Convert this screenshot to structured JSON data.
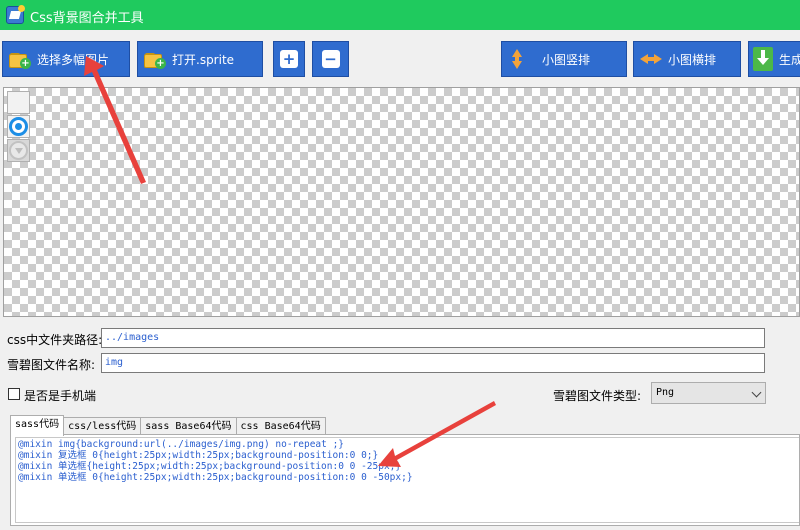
{
  "window": {
    "title": "Css背景图合并工具"
  },
  "toolbar": {
    "select_images_label": "选择多幅图片",
    "open_sprite_label": "打开.sprite",
    "zoom_in_glyph": "+",
    "zoom_out_glyph": "−",
    "arrange_vertical_label": "小图竖排",
    "arrange_horizontal_label": "小图横排",
    "generate_label": "生成"
  },
  "form": {
    "css_path_label": "css中文件夹路径:",
    "css_path_value": "../images",
    "sprite_name_label": "雪碧图文件名称:",
    "sprite_name_value": "img",
    "mobile_checkbox_label": "是否是手机端",
    "mobile_checked": false,
    "file_type_label": "雪碧图文件类型:",
    "file_type_value": "Png"
  },
  "tabs": [
    {
      "label": "sass代码",
      "active": true
    },
    {
      "label": "css/less代码",
      "active": false
    },
    {
      "label": "sass Base64代码",
      "active": false
    },
    {
      "label": "css Base64代码",
      "active": false
    }
  ],
  "code_lines": [
    "@mixin img{background:url(../images/img.png) no-repeat ;}",
    "@mixin 复选框 0{height:25px;width:25px;background-position:0 0;}",
    "@mixin 单选框{height:25px;width:25px;background-position:0 0 -25px;}",
    "@mixin 单选框 0{height:25px;width:25px;background-position:0 0 -50px;}"
  ],
  "colors": {
    "titlebar": "#1fca5e",
    "toolbar_button": "#2f6ccf",
    "code_text": "#2b5fcf",
    "annotation_arrow": "#e8413c"
  },
  "icons": [
    "app-icon",
    "folder-add-icon",
    "plus-icon",
    "minus-icon",
    "arrows-vertical-icon",
    "arrows-horizontal-icon",
    "download-icon"
  ]
}
